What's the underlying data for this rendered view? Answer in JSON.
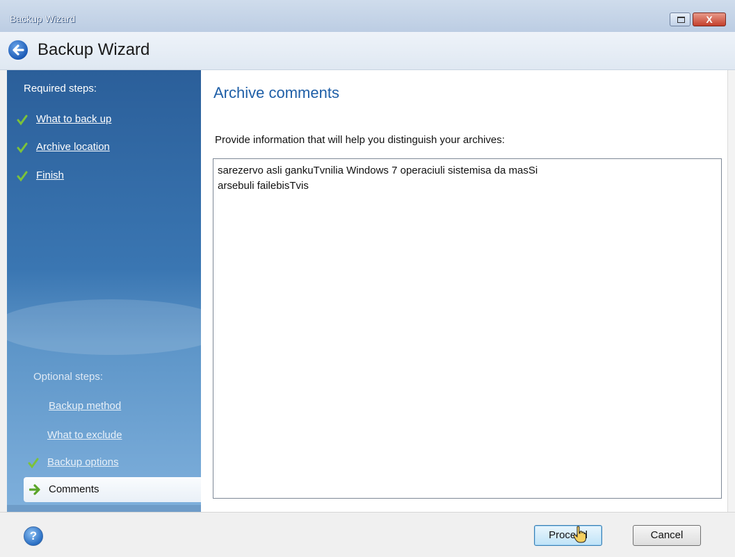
{
  "window": {
    "title": "Backup Wizard",
    "restore_icon": "restore-window-icon",
    "close_icon": "close-icon",
    "close_glyph": "X"
  },
  "header": {
    "title": "Backup Wizard",
    "back_icon": "back-arrow-icon"
  },
  "sidebar": {
    "required_heading": "Required steps:",
    "required_steps": [
      {
        "label": "What to back up",
        "status": "done"
      },
      {
        "label": "Archive location",
        "status": "done"
      },
      {
        "label": "Finish",
        "status": "done"
      }
    ],
    "optional_heading": "Optional steps:",
    "optional_steps": [
      {
        "label": "Backup method",
        "status": "pending"
      },
      {
        "label": "What to exclude",
        "status": "pending"
      },
      {
        "label": "Backup options",
        "status": "done"
      },
      {
        "label": "Comments",
        "status": "current"
      }
    ],
    "colors": {
      "check": "#7cc23a",
      "current_arrow": "#5aa52a"
    }
  },
  "main": {
    "title": "Archive comments",
    "prompt": "Provide information that will help you distinguish your archives:",
    "comment_value": "sarezervo asli gankuTvnilia Windows 7 operaciuli sistemisa da masSi\narsebuli failebisTvis"
  },
  "footer": {
    "help_icon": "help-icon",
    "help_glyph": "?",
    "proceed_label": "Proceed",
    "cancel_label": "Cancel"
  },
  "colors": {
    "accent_title": "#1f5fa7",
    "sidebar_top": "#2b5f9a",
    "sidebar_bottom": "#7fb0dc"
  }
}
